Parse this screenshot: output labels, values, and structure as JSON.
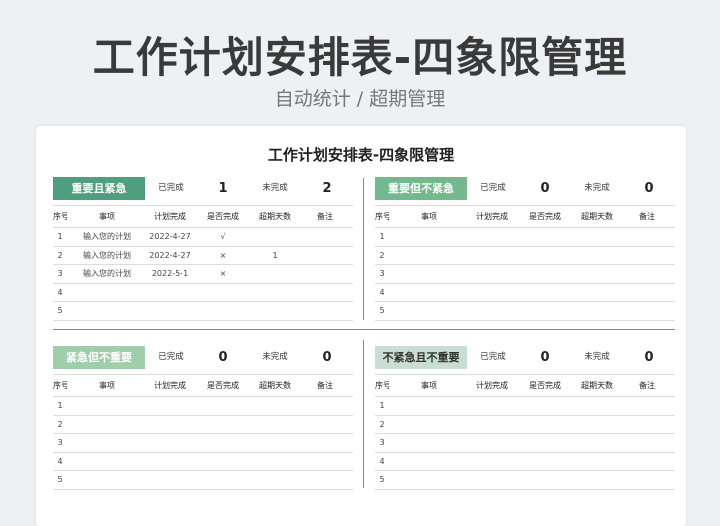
{
  "title": "工作计划安排表-四象限管理",
  "subtitle": "自动统计 / 超期管理",
  "sheet_title": "工作计划安排表-四象限管理",
  "stat_labels": {
    "done": "已完成",
    "undone": "未完成"
  },
  "columns": [
    "序号",
    "事项",
    "计划完成",
    "是否完成",
    "超期天数",
    "备注"
  ],
  "quadrants": [
    {
      "label": "重要且紧急",
      "color": "#4f9e80",
      "text_color": "#ffffff",
      "done": "1",
      "undone": "2",
      "rows": [
        [
          "1",
          "输入您的计划",
          "2022-4-27",
          "√",
          "",
          " "
        ],
        [
          "2",
          "输入您的计划",
          "2022-4-27",
          "×",
          "1",
          ""
        ],
        [
          "3",
          "输入您的计划",
          "2022-5-1",
          "×",
          "",
          ""
        ],
        [
          "4",
          "",
          "",
          "",
          "",
          ""
        ],
        [
          "5",
          "",
          "",
          "",
          "",
          ""
        ]
      ]
    },
    {
      "label": "重要但不紧急",
      "color": "#74b88e",
      "text_color": "#ffffff",
      "done": "0",
      "undone": "0",
      "rows": [
        [
          "1",
          "",
          "",
          "",
          "",
          ""
        ],
        [
          "2",
          "",
          "",
          "",
          "",
          ""
        ],
        [
          "3",
          "",
          "",
          "",
          "",
          ""
        ],
        [
          "4",
          "",
          "",
          "",
          "",
          ""
        ],
        [
          "5",
          "",
          "",
          "",
          "",
          ""
        ]
      ]
    },
    {
      "label": "紧急但不重要",
      "color": "#9fcfaa",
      "text_color": "#ffffff",
      "done": "0",
      "undone": "0",
      "rows": [
        [
          "1",
          "",
          "",
          "",
          "",
          ""
        ],
        [
          "2",
          "",
          "",
          "",
          "",
          ""
        ],
        [
          "3",
          "",
          "",
          "",
          "",
          ""
        ],
        [
          "4",
          "",
          "",
          "",
          "",
          ""
        ],
        [
          "5",
          "",
          "",
          "",
          "",
          ""
        ]
      ]
    },
    {
      "label": "不紧急且不重要",
      "color": "#c8ddd3",
      "text_color": "#333333",
      "done": "0",
      "undone": "0",
      "rows": [
        [
          "1",
          "",
          "",
          "",
          "",
          ""
        ],
        [
          "2",
          "",
          "",
          "",
          "",
          ""
        ],
        [
          "3",
          "",
          "",
          "",
          "",
          ""
        ],
        [
          "4",
          "",
          "",
          "",
          "",
          ""
        ],
        [
          "5",
          "",
          "",
          "",
          "",
          ""
        ]
      ]
    }
  ]
}
